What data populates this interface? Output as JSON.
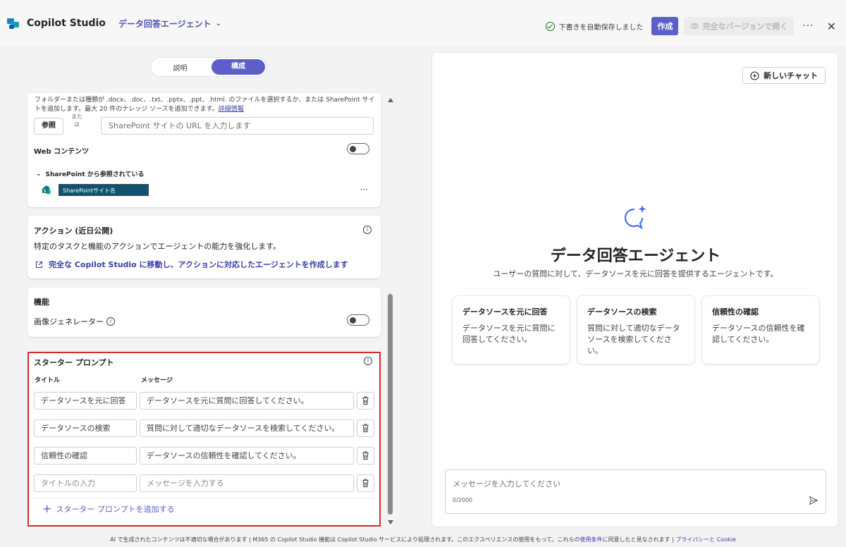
{
  "header": {
    "app_name": "Copilot Studio",
    "agent_name": "データ回答エージェント",
    "autosave": "下書きを自動保存しました",
    "create_button": "作成",
    "full_version_button": "完全なバージョンで開く",
    "more": "···",
    "close": "✕"
  },
  "tabs": {
    "describe": "説明",
    "configure": "構成",
    "active": "構成"
  },
  "knowledge": {
    "description": "フォルダーまたは種類が .docx、.doc、.txt、.pptx、.ppt、.html. のファイルを選択するか、または SharePoint サイトを追加します。最大 20 件のナレッジ ソースを追加できます。",
    "learn_more": "詳細情報",
    "browse_button": "参照",
    "or_text": "また は",
    "url_placeholder": "SharePoint サイトの URL を入力します",
    "web_content_label": "Web コンテンツ",
    "sharepoint_header": "SharePoint から参照されている",
    "sharepoint_site": "SharePointサイト名",
    "more": "···"
  },
  "actions": {
    "title": "アクション (近日公開)",
    "description": "特定のタスクと機能のアクションでエージェントの能力を強化します。",
    "link": "完全な Copilot Studio に移動し、アクションに対応したエージェントを作成します"
  },
  "capabilities": {
    "title": "機能",
    "image_generator": "画像ジェネレーター"
  },
  "starter_prompts": {
    "title": "スターター プロンプト",
    "col_title": "タイトル",
    "col_message": "メッセージ",
    "rows": [
      {
        "title": "データソースを元に回答",
        "message": "データソースを元に質問に回答してください。"
      },
      {
        "title": "データソースの検索",
        "message": "質問に対して適切なデータソースを検索してください。"
      },
      {
        "title": "信頼性の確認",
        "message": "データソースの信頼性を確認してください。"
      }
    ],
    "title_placeholder": "タイトルの入力",
    "message_placeholder": "メッセージを入力する",
    "add_label": "スターター プロンプトを追加する"
  },
  "preview": {
    "new_chat": "新しいチャット",
    "agent_title": "データ回答エージェント",
    "agent_subtitle": "ユーザーの質問に対して、データソースを元に回答を提供するエージェントです。",
    "suggestions": [
      {
        "title": "データソースを元に回答",
        "desc": "データソースを元に質問に回答してください。"
      },
      {
        "title": "データソースの検索",
        "desc": "質問に対して適切なデータソースを検索してください。"
      },
      {
        "title": "信頼性の確認",
        "desc": "データソースの信頼性を確認してください。"
      }
    ],
    "input_placeholder": "メッセージを入力してください",
    "counter": "0/2000"
  },
  "footer": {
    "text": "AI で生成されたコンテンツは不適切な場合があります | M365 の Copilot Studio 機能は Copilot Studio サービスにより処理されます。このエクスペリエンスの使用をもって、これらの",
    "terms_link": "使用条件",
    "text2": "に同意したと見なされます |",
    "privacy_link": "プライバシーと Cookie"
  },
  "colors": {
    "accent": "#5b5fc7",
    "link": "#3b3fa8",
    "highlight_border": "#d42a2a",
    "sharepoint_bg": "#0e5470",
    "success": "#107c10"
  },
  "icons": {
    "logo": "copilot-studio-logo-icon",
    "autosave": "check-circle-icon",
    "info": "info-icon",
    "trash": "trash-icon",
    "send": "send-icon",
    "chat": "chat-sparkle-icon"
  }
}
